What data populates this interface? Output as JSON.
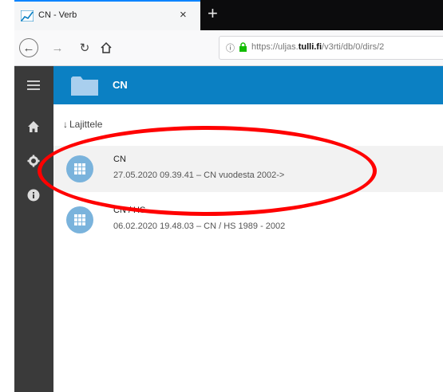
{
  "browser": {
    "tab_title": "CN - Verb",
    "tab_close": "×",
    "new_tab": "+",
    "url_prefix": "https://uljas.",
    "url_domain": "tulli.fi",
    "url_suffix": "/v3rti/db/0/dirs/2"
  },
  "app": {
    "header_title": "CN",
    "sort_label": "Lajittele",
    "items": [
      {
        "name": "CN",
        "meta": "27.05.2020 09.39.41 – CN vuodesta 2002->"
      },
      {
        "name": "CN / HS",
        "meta": "06.02.2020 19.48.03 – CN / HS 1989 - 2002"
      }
    ]
  },
  "colors": {
    "header_blue": "#0b80c3",
    "sidebar": "#3a3a3a",
    "item_icon": "#7ab3dc",
    "annotation": "#ff0000"
  }
}
